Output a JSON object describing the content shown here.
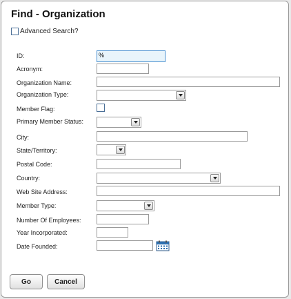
{
  "header": {
    "title": "Find - Organization"
  },
  "advanced_search": {
    "label": "Advanced Search?",
    "checked": false
  },
  "fields": {
    "id": {
      "label": "ID:",
      "value": "%"
    },
    "acronym": {
      "label": "Acronym:",
      "value": ""
    },
    "organization_name": {
      "label": "Organization Name:",
      "value": ""
    },
    "organization_type": {
      "label": "Organization Type:",
      "value": ""
    },
    "member_flag": {
      "label": "Member Flag:",
      "checked": false
    },
    "primary_member_status": {
      "label": "Primary Member Status:",
      "value": ""
    },
    "city": {
      "label": "City:",
      "value": ""
    },
    "state_territory": {
      "label": "State/Territory:",
      "value": ""
    },
    "postal_code": {
      "label": "Postal Code:",
      "value": ""
    },
    "country": {
      "label": "Country:",
      "value": ""
    },
    "web_site_address": {
      "label": "Web Site Address:",
      "value": ""
    },
    "member_type": {
      "label": "Member Type:",
      "value": ""
    },
    "number_of_employees": {
      "label": "Number Of Employees:",
      "value": ""
    },
    "year_incorporated": {
      "label": "Year Incorporated:",
      "value": ""
    },
    "date_founded": {
      "label": "Date Founded:",
      "value": "",
      "icon": "calendar-icon"
    }
  },
  "buttons": {
    "go": "Go",
    "cancel": "Cancel"
  },
  "colors": {
    "focus_border": "#4a90d0",
    "focus_bg": "#e8f4fb",
    "checkbox_border": "#4b6f97"
  }
}
